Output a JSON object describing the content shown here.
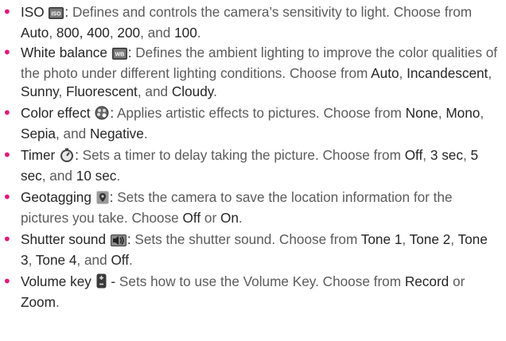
{
  "items": [
    {
      "name": "ISO",
      "icon": "iso-icon",
      "sep": ":",
      "segments": [
        {
          "t": "Defines and controls the camera’s sensitivity to light. Choose from "
        },
        {
          "t": "Auto",
          "b": true
        },
        {
          "t": ", "
        },
        {
          "t": "800,",
          "b": true
        },
        {
          "t": " "
        },
        {
          "t": "400",
          "b": true
        },
        {
          "t": ", "
        },
        {
          "t": "200",
          "b": true
        },
        {
          "t": ", and "
        },
        {
          "t": "100",
          "b": true
        },
        {
          "t": "."
        }
      ]
    },
    {
      "name": "White balance",
      "icon": "white-balance-icon",
      "sep": ":",
      "segments": [
        {
          "t": "Defines the ambient lighting to improve the color qualities of the photo under different lighting conditions. Choose from "
        },
        {
          "t": "Auto",
          "b": true
        },
        {
          "t": ", "
        },
        {
          "t": "Incandescent",
          "b": true
        },
        {
          "t": ", "
        },
        {
          "t": "Sunny",
          "b": true
        },
        {
          "t": ", "
        },
        {
          "t": "Fluorescent",
          "b": true
        },
        {
          "t": ", and "
        },
        {
          "t": "Cloudy",
          "b": true
        },
        {
          "t": "."
        }
      ]
    },
    {
      "name": "Color effect",
      "icon": "color-effect-icon",
      "sep": ":",
      "segments": [
        {
          "t": "Applies artistic effects to pictures. Choose from "
        },
        {
          "t": "None",
          "b": true
        },
        {
          "t": ", "
        },
        {
          "t": "Mono",
          "b": true
        },
        {
          "t": ", "
        },
        {
          "t": "Sepia",
          "b": true
        },
        {
          "t": ", and "
        },
        {
          "t": "Negative",
          "b": true
        },
        {
          "t": "."
        }
      ]
    },
    {
      "name": "Timer",
      "icon": "timer-icon",
      "sep": ":",
      "segments": [
        {
          "t": "Sets a timer to delay taking the picture. Choose from "
        },
        {
          "t": "Off",
          "b": true
        },
        {
          "t": ", "
        },
        {
          "t": "3 sec",
          "b": true
        },
        {
          "t": ", "
        },
        {
          "t": "5 sec",
          "b": true
        },
        {
          "t": ", and "
        },
        {
          "t": "10 sec",
          "b": true
        },
        {
          "t": "."
        }
      ]
    },
    {
      "name": "Geotagging",
      "icon": "location-pin-icon",
      "sep": ":",
      "segments": [
        {
          "t": "Sets the camera to save the location information for the pictures you take. Choose "
        },
        {
          "t": "Off",
          "b": true
        },
        {
          "t": " or "
        },
        {
          "t": "On",
          "b": true
        },
        {
          "t": "."
        }
      ]
    },
    {
      "name": "Shutter sound",
      "icon": "shutter-sound-icon",
      "sep": ":",
      "segments": [
        {
          "t": "Sets the shutter sound. Choose from "
        },
        {
          "t": "Tone 1",
          "b": true
        },
        {
          "t": ", "
        },
        {
          "t": "Tone 2",
          "b": true
        },
        {
          "t": ", "
        },
        {
          "t": "Tone 3",
          "b": true
        },
        {
          "t": ", "
        },
        {
          "t": "Tone 4",
          "b": true
        },
        {
          "t": ", and "
        },
        {
          "t": "Off",
          "b": true
        },
        {
          "t": "."
        }
      ]
    },
    {
      "name": "Volume key",
      "icon": "volume-key-icon",
      "sep": " -",
      "segments": [
        {
          "t": "Sets how to use the Volume Key. Choose from "
        },
        {
          "t": "Record",
          "b": true
        },
        {
          "t": " or "
        },
        {
          "t": "Zoom",
          "b": true
        },
        {
          "t": "."
        }
      ]
    }
  ],
  "colors": {
    "bullet": "#e2187a",
    "body": "#5b5b5b",
    "highlight": "#262626"
  }
}
